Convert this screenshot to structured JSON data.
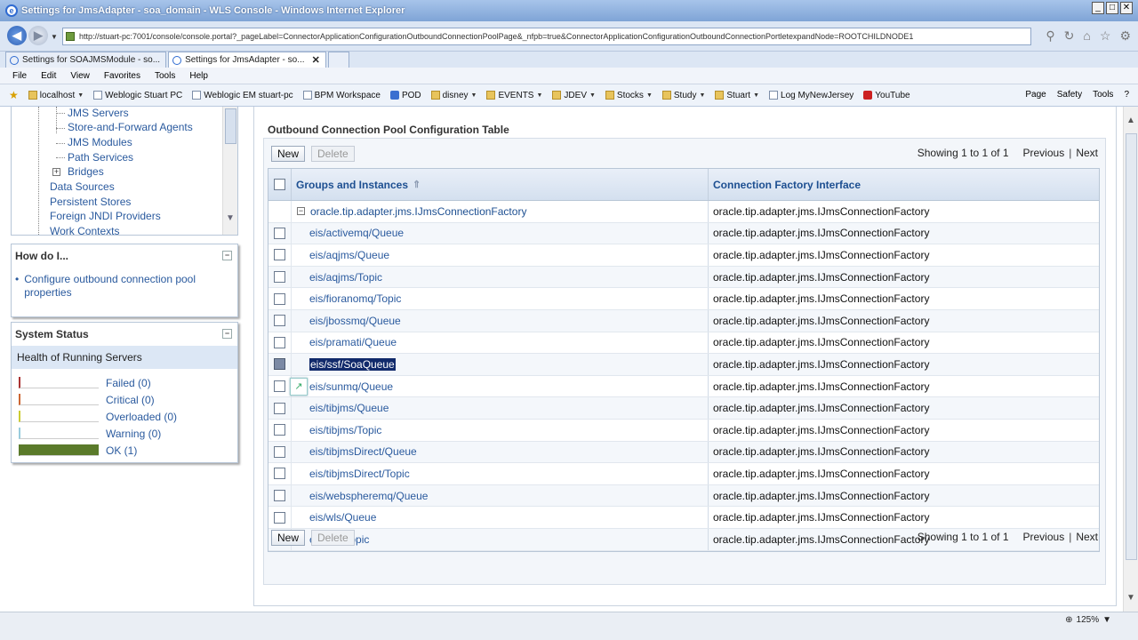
{
  "window": {
    "title": "Settings for JmsAdapter - soa_domain - WLS Console - Windows Internet Explorer"
  },
  "address": {
    "url": "http://stuart-pc:7001/console/console.portal?_pageLabel=ConnectorApplicationConfigurationOutboundConnectionPoolPage&_nfpb=true&ConnectorApplicationConfigurationOutboundConnectionPortletexpandNode=ROOTCHILDNODE1"
  },
  "tabs": [
    {
      "label": "Settings for SOAJMSModule - so..."
    },
    {
      "label": "Settings for JmsAdapter - so..."
    }
  ],
  "menu": [
    "File",
    "Edit",
    "View",
    "Favorites",
    "Tools",
    "Help"
  ],
  "favorites": [
    "localhost",
    "Weblogic Stuart PC",
    "Weblogic EM stuart-pc",
    "BPM Workspace",
    "POD",
    "disney",
    "EVENTS",
    "JDEV",
    "Stocks",
    "Study",
    "Stuart",
    "Log MyNewJersey",
    "YouTube"
  ],
  "favtools": [
    "Page",
    "Safety",
    "Tools"
  ],
  "tree": {
    "items": [
      "JMS Servers",
      "Store-and-Forward Agents",
      "JMS Modules",
      "Path Services",
      "Bridges",
      "Data Sources",
      "Persistent Stores",
      "Foreign JNDI Providers",
      "Work Contexts"
    ]
  },
  "howdo": {
    "title": "How do I...",
    "links": [
      "Configure outbound connection pool properties"
    ]
  },
  "status": {
    "title": "System Status",
    "subtitle": "Health of Running Servers",
    "rows": [
      {
        "label": "Failed (0)",
        "color": "#a33"
      },
      {
        "label": "Critical (0)",
        "color": "#c63"
      },
      {
        "label": "Overloaded (0)",
        "color": "#cc3"
      },
      {
        "label": "Warning (0)",
        "color": "#9cd"
      },
      {
        "label": "OK (1)",
        "color": "#5a7a2a",
        "level": 1
      }
    ]
  },
  "main": {
    "table_title": "Outbound Connection Pool Configuration Table",
    "new_label": "New",
    "delete_label": "Delete",
    "pager": {
      "showing": "Showing 1 to 1 of 1",
      "previous": "Previous",
      "next": "Next"
    },
    "columns": {
      "groups": "Groups and Instances",
      "factory": "Connection Factory Interface"
    },
    "group": {
      "name": "oracle.tip.adapter.jms.IJmsConnectionFactory",
      "factory": "oracle.tip.adapter.jms.IJmsConnectionFactory"
    },
    "rows": [
      {
        "name": "eis/activemq/Queue",
        "factory": "oracle.tip.adapter.jms.IJmsConnectionFactory"
      },
      {
        "name": "eis/aqjms/Queue",
        "factory": "oracle.tip.adapter.jms.IJmsConnectionFactory"
      },
      {
        "name": "eis/aqjms/Topic",
        "factory": "oracle.tip.adapter.jms.IJmsConnectionFactory"
      },
      {
        "name": "eis/fioranomq/Topic",
        "factory": "oracle.tip.adapter.jms.IJmsConnectionFactory"
      },
      {
        "name": "eis/jbossmq/Queue",
        "factory": "oracle.tip.adapter.jms.IJmsConnectionFactory"
      },
      {
        "name": "eis/pramati/Queue",
        "factory": "oracle.tip.adapter.jms.IJmsConnectionFactory"
      },
      {
        "name": "eis/ssf/SoaQueue",
        "factory": "oracle.tip.adapter.jms.IJmsConnectionFactory",
        "selected": true
      },
      {
        "name": "eis/sunmq/Queue",
        "factory": "oracle.tip.adapter.jms.IJmsConnectionFactory"
      },
      {
        "name": "eis/tibjms/Queue",
        "factory": "oracle.tip.adapter.jms.IJmsConnectionFactory"
      },
      {
        "name": "eis/tibjms/Topic",
        "factory": "oracle.tip.adapter.jms.IJmsConnectionFactory"
      },
      {
        "name": "eis/tibjmsDirect/Queue",
        "factory": "oracle.tip.adapter.jms.IJmsConnectionFactory"
      },
      {
        "name": "eis/tibjmsDirect/Topic",
        "factory": "oracle.tip.adapter.jms.IJmsConnectionFactory"
      },
      {
        "name": "eis/webspheremq/Queue",
        "factory": "oracle.tip.adapter.jms.IJmsConnectionFactory"
      },
      {
        "name": "eis/wls/Queue",
        "factory": "oracle.tip.adapter.jms.IJmsConnectionFactory"
      },
      {
        "name": "eis/wls/Topic",
        "factory": "oracle.tip.adapter.jms.IJmsConnectionFactory"
      }
    ]
  },
  "statusbar": {
    "zoom": "125%"
  }
}
